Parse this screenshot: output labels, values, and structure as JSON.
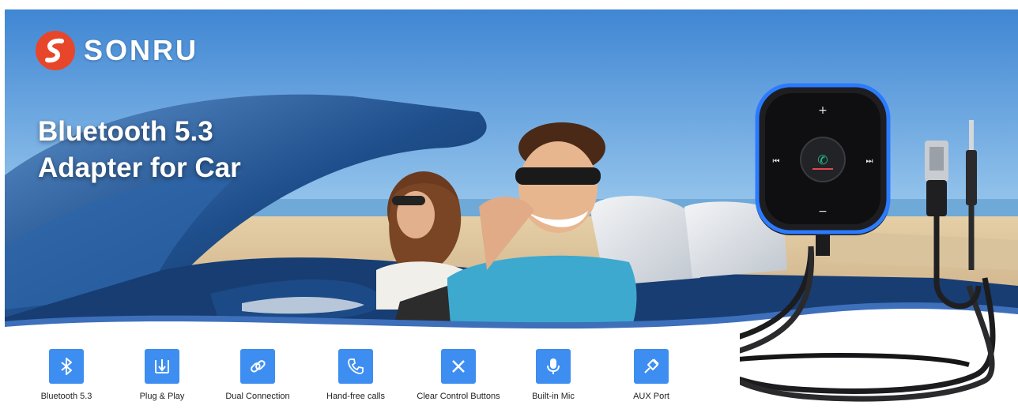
{
  "brand": {
    "name": "SONRU"
  },
  "headline": {
    "line1": "Bluetooth 5.3",
    "line2": "Adapter for Car"
  },
  "features": [
    {
      "label": "Bluetooth 5.3",
      "icon": "bluetooth-icon"
    },
    {
      "label": "Plug & Play",
      "icon": "plug-play-icon"
    },
    {
      "label": "Dual Connection",
      "icon": "link-icon"
    },
    {
      "label": "Hand-free calls",
      "icon": "phone-icon"
    },
    {
      "label": "Clear Control Buttons",
      "icon": "close-x-icon"
    },
    {
      "label": "Built-in Mic",
      "icon": "microphone-icon"
    },
    {
      "label": "AUX Port",
      "icon": "aux-plug-icon"
    }
  ],
  "device": {
    "plus": "+",
    "minus": "−",
    "prev": "⏮",
    "next": "⏭"
  },
  "colors": {
    "accent": "#3d8ef0",
    "brand_red": "#e8462a",
    "sky": "#4d8fd6",
    "car_blue": "#1d4f8f",
    "ring_blue": "#2b7bff"
  }
}
